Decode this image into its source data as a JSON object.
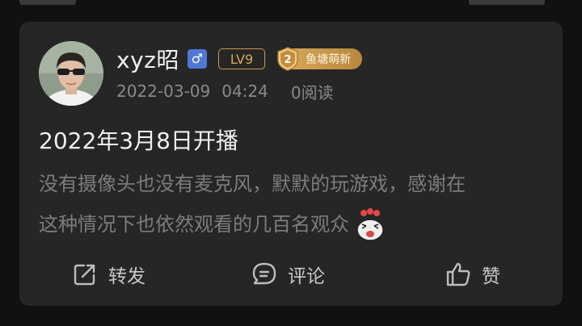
{
  "post": {
    "username": "xyz昭",
    "gender_symbol": "♂",
    "level": "LV9",
    "fan_badge": {
      "number": "2",
      "label": "鱼塘萌新"
    },
    "date": "2022-03-09",
    "time": "04:24",
    "reads": "0阅读",
    "title": "2022年3月8日开播",
    "body_line1": "没有摄像头也没有麦克风，默默的玩游戏，感谢在",
    "body_line2": "这种情况下也依然观看的几百名观众"
  },
  "actions": {
    "share_label": "转发",
    "comment_label": "评论",
    "like_label": "赞"
  },
  "colors": {
    "card_bg": "#262626",
    "page_bg": "#111111",
    "level_gold": "#d7a857",
    "gender_blue": "#4f78d6",
    "muted_text": "#8a8a8a"
  }
}
